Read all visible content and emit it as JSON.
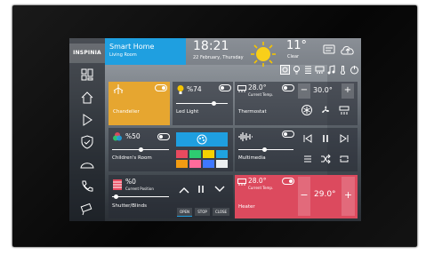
{
  "brand": {
    "logo_text": "INSPINIA"
  },
  "header": {
    "room_title": "Smart Home",
    "room_subtitle": "Living Room",
    "time": "18:21",
    "date": "22 February, Thursday",
    "temperature": "11°",
    "weather": "Clear"
  },
  "toolbar": {
    "icons": [
      "scene-icon",
      "bulb-icon",
      "blinds-icon",
      "ac-icon",
      "music-icon",
      "thermo-icon",
      "power-icon"
    ]
  },
  "sidebar": {
    "items": [
      "dashboard-icon",
      "home-icon",
      "play-icon",
      "shield-icon",
      "garage-icon",
      "phone-icon",
      "camera-icon"
    ]
  },
  "tiles": {
    "chandelier": {
      "label": "Chandelier",
      "color": "#e6a630"
    },
    "led_light": {
      "label": "Led Light",
      "value": "%74"
    },
    "thermostat": {
      "label": "Thermostat",
      "current_temp": "28.0°",
      "current_temp_label": "Current Temp.",
      "set_temp": "30.0°",
      "minus": "−",
      "plus": "+"
    },
    "childrens_room": {
      "label": "Children's Room",
      "value": "%50",
      "swatches": [
        "#e84a5f",
        "#2ecc71",
        "#f5d100",
        "#1fa3e0",
        "#f39c12",
        "#ff6b9a",
        "#3f78ff",
        "#ecf0f1"
      ]
    },
    "multimedia": {
      "label": "Multimedia"
    },
    "shutter": {
      "label": "Shutter/Blinds",
      "value": "%0",
      "value_label": "Current Position",
      "open": "OPEN",
      "stop": "STOP",
      "close": "CLOSE"
    },
    "heater": {
      "label": "Heater",
      "current_temp": "28.0°",
      "current_temp_label": "Current Temp.",
      "set_temp": "29.0°",
      "minus": "−",
      "plus": "+",
      "color": "#dc4a5e"
    }
  }
}
